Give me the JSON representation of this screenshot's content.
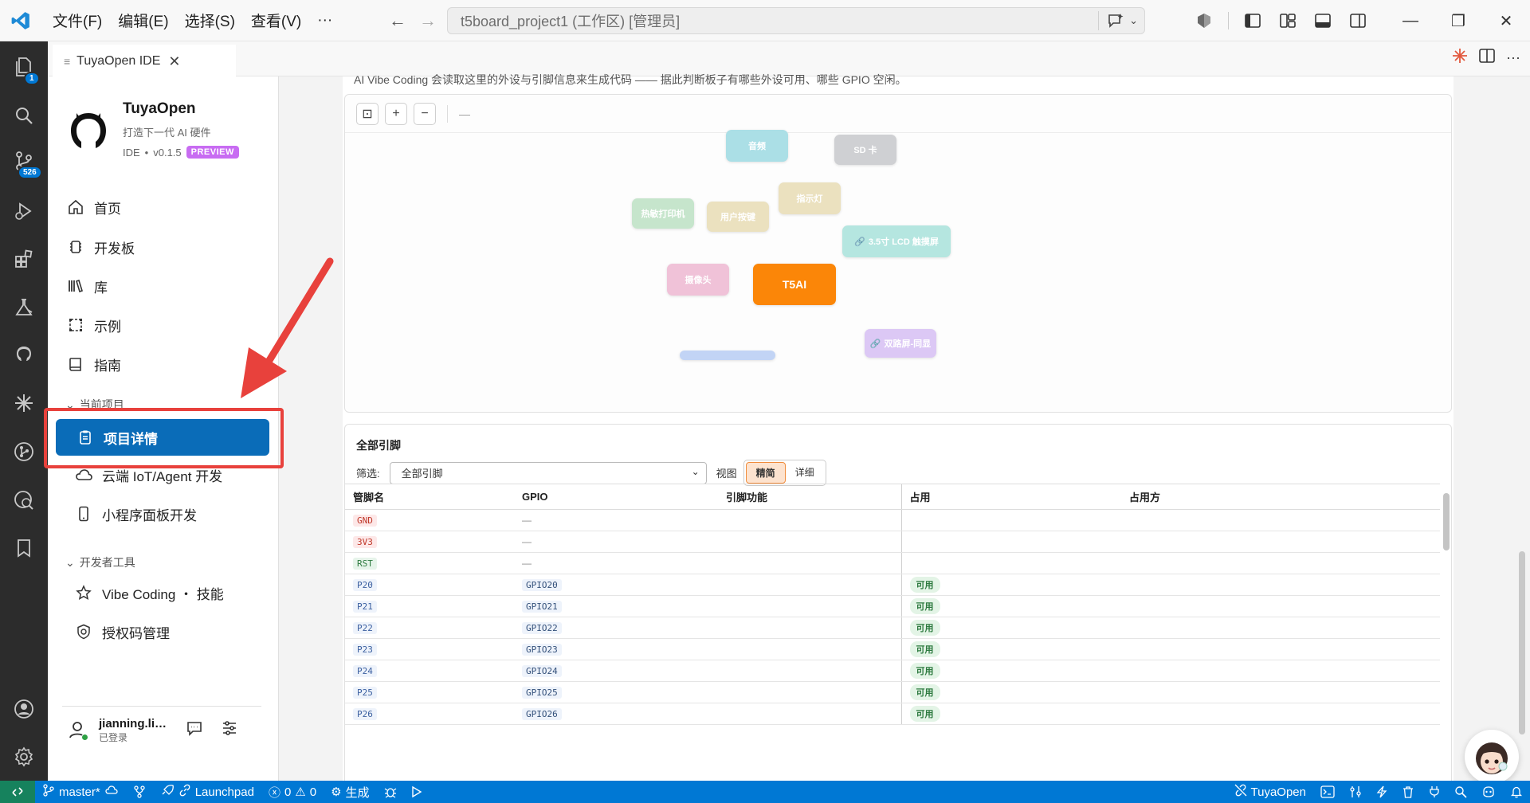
{
  "titlebar": {
    "menus": [
      "文件(F)",
      "编辑(E)",
      "选择(S)",
      "查看(V)",
      "···"
    ],
    "search_text": "t5board_project1 (工作区) [管理员]"
  },
  "activity": {
    "explorer_badge": "1",
    "scm_badge": "526"
  },
  "tab": {
    "label": "TuyaOpen IDE"
  },
  "brand": {
    "name": "TuyaOpen",
    "tagline": "打造下一代 AI 硬件",
    "ide": "IDE",
    "dot": "•",
    "version": "v0.1.5",
    "badge": "PREVIEW"
  },
  "nav": {
    "home": "首页",
    "boards": "开发板",
    "library": "库",
    "examples": "示例",
    "guide": "指南",
    "current_project": "当前项目",
    "project_detail": "项目详情",
    "cloud": "云端 IoT/Agent 开发",
    "miniprogram": "小程序面板开发",
    "devtools": "开发者工具",
    "vibe": "Vibe Coding ・ 技能",
    "license": "授权码管理"
  },
  "user": {
    "name": "jianning.li…",
    "status": "已登录"
  },
  "content": {
    "hint": "AI Vibe Coding 会读取这里的外设与引脚信息来生成代码 —— 据此判断板子有哪些外设可用、哪些 GPIO 空闲。",
    "toolbar_dash": "—",
    "nodes": {
      "audio": "音频",
      "sd": "SD 卡",
      "led": "指示灯",
      "printer": "热敏打印机",
      "button": "用户按键",
      "lcd": "3.5寸 LCD 触摸屏",
      "camera": "摄像头",
      "chip": "T5AI",
      "dual": "双路屏-同显"
    },
    "node_colors": {
      "audio": "#abdfe6",
      "sd": "#cfd0d3",
      "led": "#ebe1bf",
      "printer": "#c6e5cc",
      "button": "#ebe1bf",
      "lcd": "#b5e6e0",
      "camera": "#f0c2d8",
      "chip": "#fb8608",
      "dual": "#dcc8f5",
      "hidden": "#c2d4f5"
    }
  },
  "pins": {
    "title": "全部引脚",
    "filter_label": "筛选:",
    "filter_value": "全部引脚",
    "view_label": "视图",
    "view_compact": "精简",
    "view_detail": "详细",
    "headers": {
      "pin": "管脚名",
      "gpio": "GPIO",
      "func": "引脚功能",
      "used": "占用",
      "user": "占用方"
    },
    "rows": [
      {
        "pin": "GND",
        "gpio": "—",
        "status": ""
      },
      {
        "pin": "3V3",
        "gpio": "—",
        "status": ""
      },
      {
        "pin": "RST",
        "gpio": "—",
        "status": ""
      },
      {
        "pin": "P20",
        "gpio": "GPIO20",
        "status": "可用"
      },
      {
        "pin": "P21",
        "gpio": "GPIO21",
        "status": "可用"
      },
      {
        "pin": "P22",
        "gpio": "GPIO22",
        "status": "可用"
      },
      {
        "pin": "P23",
        "gpio": "GPIO23",
        "status": "可用"
      },
      {
        "pin": "P24",
        "gpio": "GPIO24",
        "status": "可用"
      },
      {
        "pin": "P25",
        "gpio": "GPIO25",
        "status": "可用"
      },
      {
        "pin": "P26",
        "gpio": "GPIO26",
        "status": "可用"
      }
    ]
  },
  "statusbar": {
    "branch": "master*",
    "launchpad": "Launchpad",
    "errors": "0",
    "warnings": "0",
    "build": "生成",
    "tuya": "TuyaOpen"
  }
}
